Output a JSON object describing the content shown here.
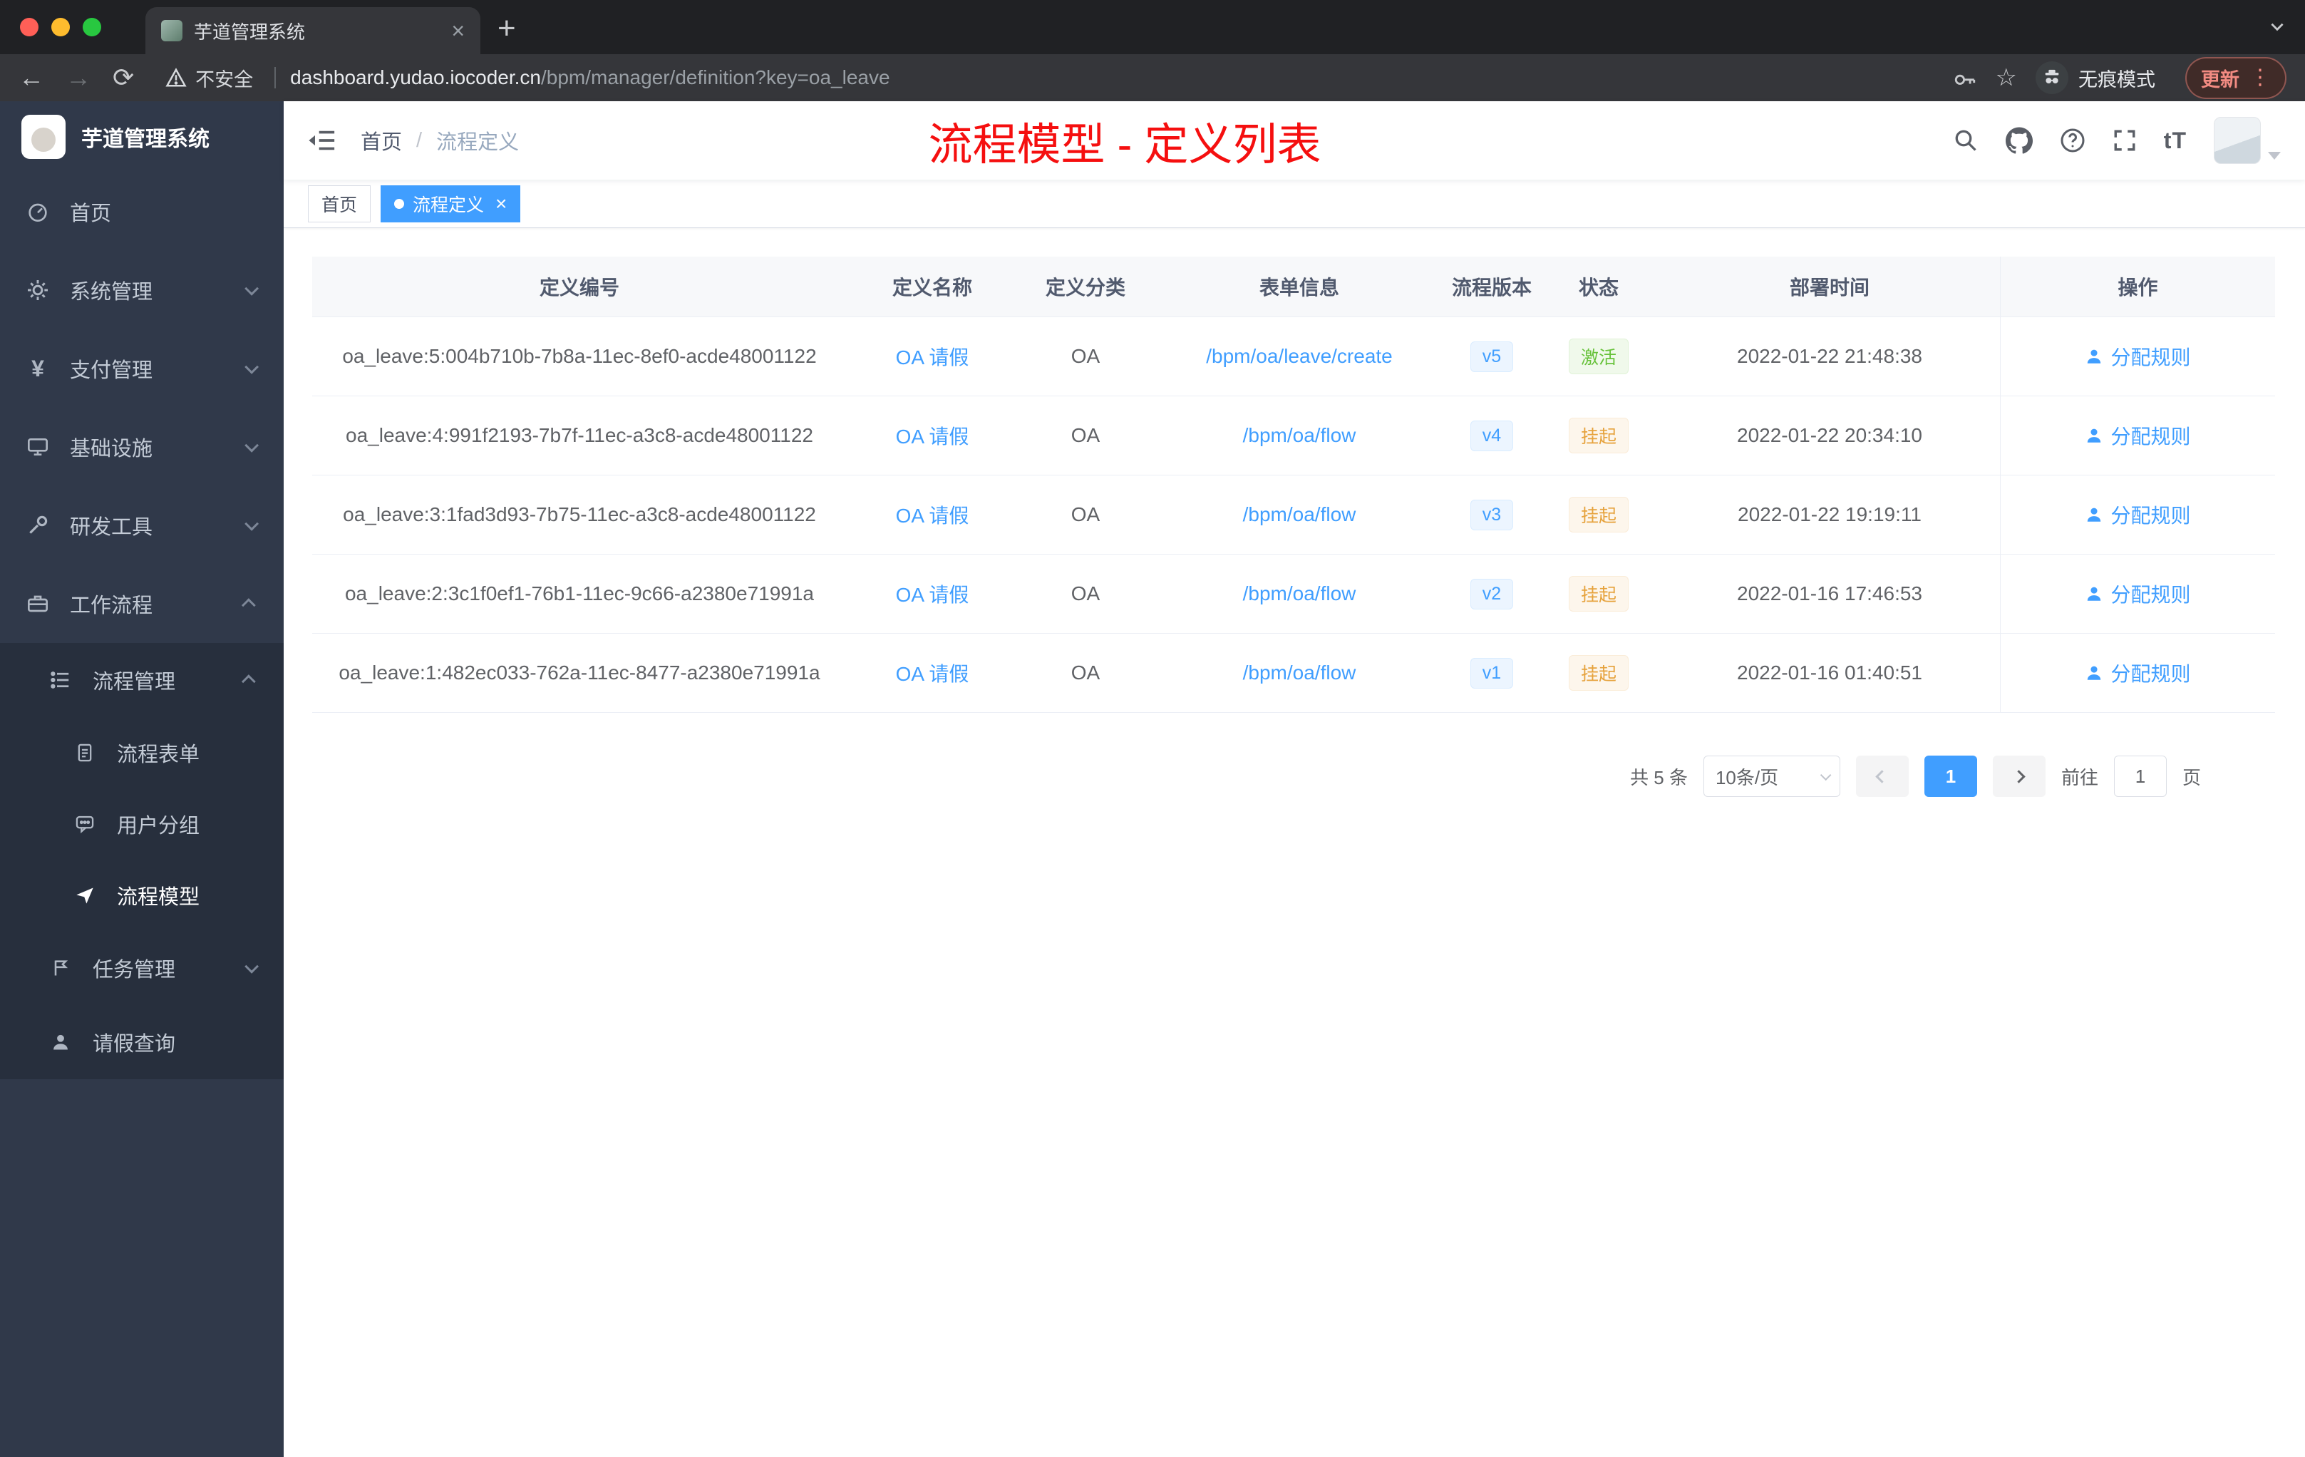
{
  "browser": {
    "tab_title": "芋道管理系统",
    "security_label": "不安全",
    "url_host": "dashboard.yudao.iocoder.cn",
    "url_path": "/bpm/manager/definition?key=oa_leave",
    "incognito_label": "无痕模式",
    "update_label": "更新"
  },
  "sidebar": {
    "logo_title": "芋道管理系统",
    "items": [
      {
        "label": "首页"
      },
      {
        "label": "系统管理"
      },
      {
        "label": "支付管理"
      },
      {
        "label": "基础设施"
      },
      {
        "label": "研发工具"
      },
      {
        "label": "工作流程"
      },
      {
        "label": "流程管理"
      },
      {
        "label": "流程表单"
      },
      {
        "label": "用户分组"
      },
      {
        "label": "流程模型"
      },
      {
        "label": "任务管理"
      },
      {
        "label": "请假查询"
      }
    ]
  },
  "header": {
    "breadcrumb_home": "首页",
    "breadcrumb_current": "流程定义",
    "annotation": "流程模型 - 定义列表",
    "font_size_icon_label": "tT"
  },
  "tags": {
    "home": "首页",
    "active": "流程定义"
  },
  "table": {
    "columns": [
      "定义编号",
      "定义名称",
      "定义分类",
      "表单信息",
      "流程版本",
      "状态",
      "部署时间",
      "操作"
    ],
    "rows": [
      {
        "id": "oa_leave:5:004b710b-7b8a-11ec-8ef0-acde48001122",
        "name": "OA 请假",
        "category": "OA",
        "form": "/bpm/oa/leave/create",
        "version": "v5",
        "status": "激活",
        "status_type": "success",
        "deploy_time": "2022-01-22 21:48:38",
        "action": "分配规则"
      },
      {
        "id": "oa_leave:4:991f2193-7b7f-11ec-a3c8-acde48001122",
        "name": "OA 请假",
        "category": "OA",
        "form": "/bpm/oa/flow",
        "version": "v4",
        "status": "挂起",
        "status_type": "warning",
        "deploy_time": "2022-01-22 20:34:10",
        "action": "分配规则"
      },
      {
        "id": "oa_leave:3:1fad3d93-7b75-11ec-a3c8-acde48001122",
        "name": "OA 请假",
        "category": "OA",
        "form": "/bpm/oa/flow",
        "version": "v3",
        "status": "挂起",
        "status_type": "warning",
        "deploy_time": "2022-01-22 19:19:11",
        "action": "分配规则"
      },
      {
        "id": "oa_leave:2:3c1f0ef1-76b1-11ec-9c66-a2380e71991a",
        "name": "OA 请假",
        "category": "OA",
        "form": "/bpm/oa/flow",
        "version": "v2",
        "status": "挂起",
        "status_type": "warning",
        "deploy_time": "2022-01-16 17:46:53",
        "action": "分配规则"
      },
      {
        "id": "oa_leave:1:482ec033-762a-11ec-8477-a2380e71991a",
        "name": "OA 请假",
        "category": "OA",
        "form": "/bpm/oa/flow",
        "version": "v1",
        "status": "挂起",
        "status_type": "warning",
        "deploy_time": "2022-01-16 01:40:51",
        "action": "分配规则"
      }
    ]
  },
  "pagination": {
    "total": "共 5 条",
    "page_size": "10条/页",
    "page": "1",
    "goto": "前往",
    "goto_value": "1",
    "unit": "页"
  },
  "colors": {
    "accent": "#409eff",
    "success": "#67c23a",
    "warning": "#e6a23c",
    "annotation": "#f50f0f",
    "sidebar_bg": "#30394a"
  }
}
